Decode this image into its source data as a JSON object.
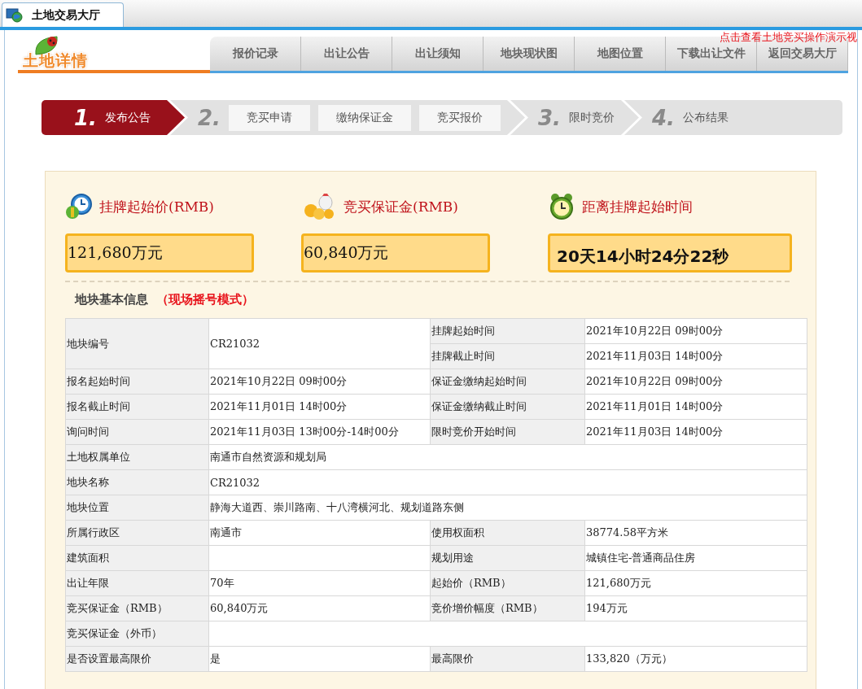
{
  "browser_tab": {
    "title": "土地交易大厅"
  },
  "header": {
    "logo": "土地详情",
    "demo_link": "点击查看土地竞买操作演示视",
    "nav": [
      {
        "label": "报价记录",
        "selected": false
      },
      {
        "label": "出让公告",
        "selected": false
      },
      {
        "label": "出让须知",
        "selected": false
      },
      {
        "label": "地块现状图",
        "selected": false
      },
      {
        "label": "地图位置",
        "selected": false
      },
      {
        "label": "下载出让文件",
        "selected": false
      },
      {
        "label": "返回交易大厅",
        "selected": false
      }
    ]
  },
  "steps": [
    {
      "kind": "step",
      "number": "1.",
      "label": "发布公告",
      "selected": true
    },
    {
      "kind": "group",
      "number": "2.",
      "substeps": [
        "竞买申请",
        "缴纳保证金",
        "竞买报价"
      ],
      "selected": false
    },
    {
      "kind": "step",
      "number": "3.",
      "label": "限时竞价",
      "selected": false
    },
    {
      "kind": "step",
      "number": "4.",
      "label": "公布结果",
      "selected": false
    }
  ],
  "summary": [
    {
      "kind": "amount",
      "title": "挂牌起始价(RMB)",
      "value": "121,680万元"
    },
    {
      "kind": "amount",
      "title": "竞买保证金(RMB)",
      "value": "60,840万元"
    },
    {
      "kind": "countdown",
      "title": "距离挂牌起始时间",
      "value": "20天14小时24分22秒"
    }
  ],
  "section": {
    "title": "地块基本信息",
    "mode": "（现场摇号模式）"
  },
  "rows": [
    {
      "label": "地块编号",
      "value": "CR21032",
      "pairs": [
        {
          "label": "挂牌起始时间",
          "value": "2021年10月22日 09时00分"
        },
        {
          "label": "挂牌截止时间",
          "value": "2021年11月03日 14时00分"
        }
      ]
    },
    {
      "label": "报名起始时间",
      "value": "2021年10月22日 09时00分",
      "pairs": [
        {
          "label": "保证金缴纳起始时间",
          "value": "2021年10月22日 09时00分"
        }
      ]
    },
    {
      "label": "报名截止时间",
      "value": "2021年11月01日 14时00分",
      "pairs": [
        {
          "label": "保证金缴纳截止时间",
          "value": "2021年11月01日 14时00分"
        }
      ]
    },
    {
      "label": "询问时间",
      "value": "2021年11月03日 13时00分-14时00分",
      "pairs": [
        {
          "label": "限时竞价开始时间",
          "value": "2021年11月03日 14时00分"
        }
      ]
    },
    {
      "label": "土地权属单位",
      "value": "南通市自然资源和规划局"
    },
    {
      "label": "地块名称",
      "value": "CR21032"
    },
    {
      "label": "地块位置",
      "value": "静海大道西、崇川路南、十八湾横河北、规划道路东侧"
    },
    {
      "label": "所属行政区",
      "value": "南通市",
      "pairs": [
        {
          "label": "使用权面积",
          "value": "38774.58平方米"
        }
      ]
    },
    {
      "label": "建筑面积",
      "pairs": [
        {
          "label": "规划用途",
          "value": "城镇住宅-普通商品住房"
        }
      ]
    },
    {
      "label": "出让年限",
      "value": "70年",
      "pairs": [
        {
          "label": "起始价（RMB）",
          "value": "121,680万元"
        }
      ]
    },
    {
      "label": "竞买保证金（RMB）",
      "value": "60,840万元",
      "pairs": [
        {
          "label": "竞价增价幅度（RMB）",
          "value": "194万元"
        }
      ]
    },
    {
      "label": "竞买保证金（外币）"
    },
    {
      "label": "是否设置最高限价",
      "value": "是",
      "pairs": [
        {
          "label": "最高限价",
          "value": "133,820（万元）"
        }
      ]
    }
  ]
}
